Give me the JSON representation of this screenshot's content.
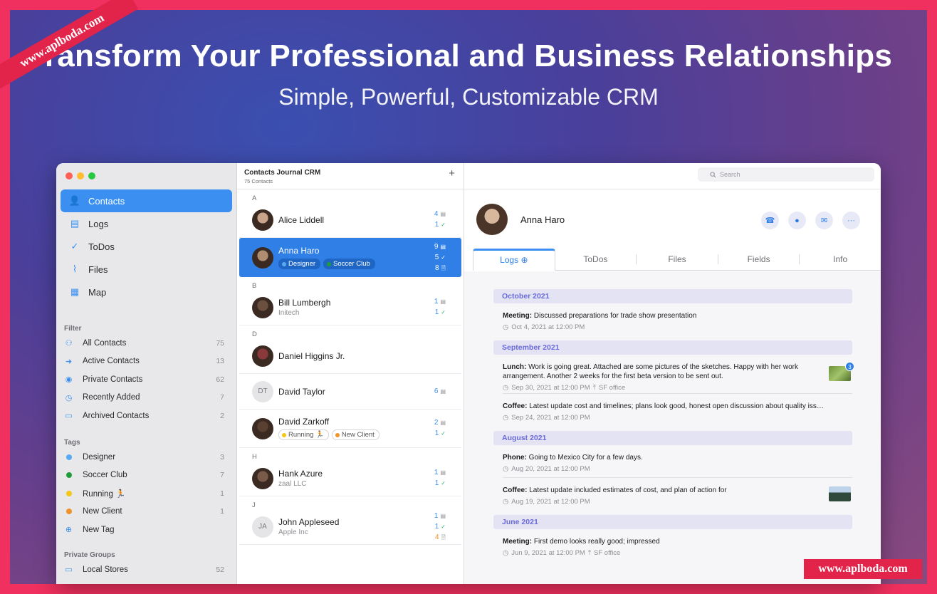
{
  "promo": {
    "headline": "ransform Your Professional and Business Relationships",
    "subheadline": "Simple, Powerful, Customizable CRM",
    "watermark_ribbon": "www.aplboda.com",
    "watermark_stamp": "www.aplboda.com"
  },
  "colors": {
    "accent": "#3b8ff0",
    "selected_row": "#2f7fe6",
    "brand_banner": "#f0305e",
    "month_header": "#e3e3f3"
  },
  "sidebar": {
    "nav": [
      {
        "label": "Contacts",
        "icon": "person-icon",
        "active": true
      },
      {
        "label": "Logs",
        "icon": "document-icon"
      },
      {
        "label": "ToDos",
        "icon": "checkmark-circle-icon"
      },
      {
        "label": "Files",
        "icon": "paperclip-icon"
      },
      {
        "label": "Map",
        "icon": "map-icon"
      }
    ],
    "filter_title": "Filter",
    "filters": [
      {
        "label": "All Contacts",
        "count": "75",
        "icon": "people-icon"
      },
      {
        "label": "Active Contacts",
        "count": "13",
        "icon": "arrow-circle-icon"
      },
      {
        "label": "Private Contacts",
        "count": "62",
        "icon": "person-circle-icon"
      },
      {
        "label": "Recently Added",
        "count": "7",
        "icon": "clock-icon"
      },
      {
        "label": "Archived Contacts",
        "count": "2",
        "icon": "archive-box-icon"
      }
    ],
    "tags_title": "Tags",
    "tags": [
      {
        "label": "Designer",
        "count": "3",
        "color": "#5aa9f5"
      },
      {
        "label": "Soccer Club",
        "count": "7",
        "color": "#1f9d3a"
      },
      {
        "label": "Running 🏃",
        "count": "1",
        "color": "#f5c518"
      },
      {
        "label": "New Client",
        "count": "1",
        "color": "#f0922a"
      }
    ],
    "new_tag": "New Tag",
    "groups_title": "Private Groups",
    "groups": [
      {
        "label": "Local Stores",
        "count": "52"
      }
    ]
  },
  "list": {
    "title": "Contacts Journal CRM",
    "subtitle": "75 Contacts",
    "add": "+",
    "sections": [
      {
        "letter": "A",
        "contacts": [
          {
            "name": "Alice Liddell",
            "counts": [
              {
                "n": "4",
                "kind": "log"
              },
              {
                "n": "1",
                "kind": "todo"
              }
            ],
            "avatar": "#c9a48a"
          },
          {
            "name": "Anna Haro",
            "selected": true,
            "tags": [
              {
                "label": "Designer",
                "color": "#5aa9f5"
              },
              {
                "label": "Soccer Club",
                "color": "#1f9d3a"
              }
            ],
            "counts": [
              {
                "n": "9",
                "kind": "log"
              },
              {
                "n": "5",
                "kind": "todo"
              },
              {
                "n": "8",
                "kind": "file"
              }
            ],
            "avatar": "#b08c70"
          }
        ]
      },
      {
        "letter": "B",
        "contacts": [
          {
            "name": "Bill Lumbergh",
            "sub": "Initech",
            "counts": [
              {
                "n": "1",
                "kind": "log"
              },
              {
                "n": "1",
                "kind": "todo"
              }
            ],
            "avatar": "#6b5040"
          }
        ]
      },
      {
        "letter": "D",
        "contacts": [
          {
            "name": "Daniel Higgins Jr.",
            "counts": [],
            "avatar": "#8a3a3a"
          },
          {
            "name": "David Taylor",
            "initials": "DT",
            "counts": [
              {
                "n": "6",
                "kind": "log"
              }
            ]
          },
          {
            "name": "David Zarkoff",
            "tags": [
              {
                "label": "Running 🏃",
                "color": "#f5c518"
              },
              {
                "label": "New Client",
                "color": "#f0922a"
              }
            ],
            "counts": [
              {
                "n": "2",
                "kind": "log"
              },
              {
                "n": "1",
                "kind": "todo"
              }
            ],
            "avatar": "#5a4030"
          }
        ]
      },
      {
        "letter": "H",
        "contacts": [
          {
            "name": "Hank Azure",
            "sub": "zaal LLC",
            "counts": [
              {
                "n": "1",
                "kind": "log"
              },
              {
                "n": "1",
                "kind": "todo"
              }
            ],
            "avatar": "#7a5a48"
          }
        ]
      },
      {
        "letter": "J",
        "contacts": [
          {
            "name": "John Appleseed",
            "sub": "Apple Inc",
            "initials": "JA",
            "counts": [
              {
                "n": "1",
                "kind": "log"
              },
              {
                "n": "1",
                "kind": "todo"
              },
              {
                "n": "4",
                "kind": "file"
              }
            ]
          }
        ]
      }
    ]
  },
  "detail": {
    "search_placeholder": "Search",
    "name": "Anna Haro",
    "actions": [
      "phone-icon",
      "message-icon",
      "mail-icon",
      "more-icon"
    ],
    "tabs": [
      "Logs",
      "ToDos",
      "Files",
      "Fields",
      "Info"
    ],
    "months": [
      {
        "label": "October 2021",
        "entries": [
          {
            "type": "Meeting:",
            "text": "Discussed preparations for trade show presentation",
            "date": "Oct 4, 2021 at 12:00 PM"
          }
        ]
      },
      {
        "label": "September 2021",
        "entries": [
          {
            "type": "Lunch:",
            "text": "Work is going great. Attached are some pictures of the sketches. Happy with her work arrangement. Another 2 weeks for the first beta version to be sent out.",
            "date": "Sep 30, 2021 at 12:00 PM",
            "place": "SF office",
            "thumb": true,
            "badge": "3"
          },
          {
            "type": "Coffee:",
            "text": "Latest update cost and timelines; plans look good, honest open discussion about quality iss…",
            "date": "Sep 24, 2021 at 12:00 PM"
          }
        ]
      },
      {
        "label": "August 2021",
        "entries": [
          {
            "type": "Phone:",
            "text": "Going to Mexico City for a few days.",
            "date": "Aug 20, 2021 at 12:00 PM"
          },
          {
            "type": "Coffee:",
            "text": "Latest update included estimates of cost, and plan of action for",
            "date": "Aug 19, 2021 at 12:00 PM",
            "thumb": true
          }
        ]
      },
      {
        "label": "June 2021",
        "entries": [
          {
            "type": "Meeting:",
            "text": "First demo looks really good; impressed",
            "date": "Jun 9, 2021 at 12:00 PM",
            "place": "SF office"
          }
        ]
      }
    ]
  }
}
